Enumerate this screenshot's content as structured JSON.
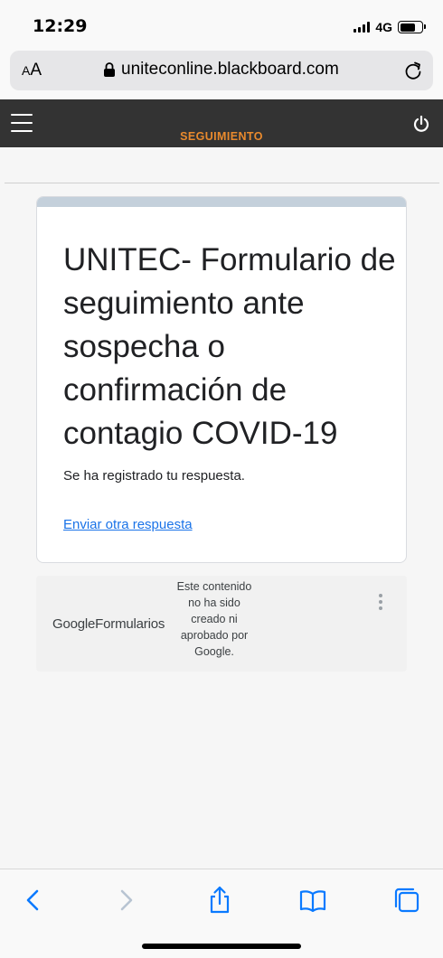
{
  "status": {
    "time": "12:29",
    "network": "4G"
  },
  "browser": {
    "text_size_button": {
      "small": "A",
      "large": "A"
    },
    "url": "uniteconline.blackboard.com"
  },
  "app_nav": {
    "title": "SEGUIMIENTO"
  },
  "form": {
    "title": "UNITEC- Formulario de seguimiento ante sospecha o confirmación de contagio COVID-19",
    "confirmation": "Se ha registrado tu respuesta.",
    "another_response_link": "Enviar otra respuesta",
    "top_band_color": "#c4d0db"
  },
  "footer": {
    "logo_google": "Google",
    "logo_product": "Formularios",
    "disclaimer": "Este contenido no ha sido creado ni aprobado por Google."
  },
  "icons": {
    "menu": "hamburger-icon",
    "power": "power-icon",
    "lock": "lock-icon",
    "reload": "reload-icon",
    "more": "kebab-icon",
    "back": "chevron-left-icon",
    "forward": "chevron-right-icon",
    "share": "share-icon",
    "bookmarks": "book-icon",
    "tabs": "tabs-icon"
  },
  "colors": {
    "nav_background": "#333333",
    "nav_title": "#e98a2d",
    "link": "#1a73e8",
    "toolbar_active": "#0a7aff",
    "toolbar_disabled": "#b8c4d2"
  }
}
